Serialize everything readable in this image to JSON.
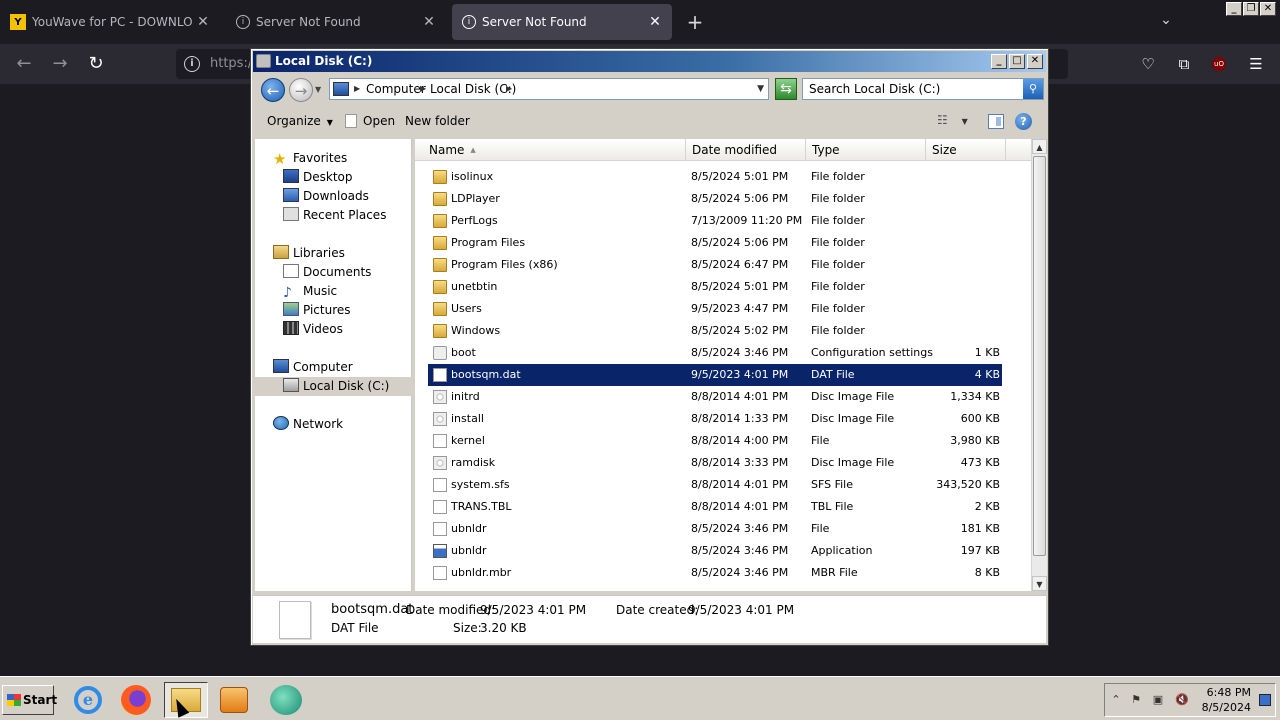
{
  "browser": {
    "tabs": [
      {
        "title": "YouWave for PC - DOWNLOAD",
        "active": false
      },
      {
        "title": "Server Not Found",
        "active": false
      },
      {
        "title": "Server Not Found",
        "active": true
      }
    ],
    "new_tab_glyph": "+",
    "url_text": "https:/"
  },
  "explorer": {
    "title": "Local Disk (C:)",
    "address": {
      "crumbs": [
        "Computer",
        "Local Disk (C:)"
      ]
    },
    "search_placeholder": "Search Local Disk (C:)",
    "commands": {
      "organize": "Organize",
      "open": "Open",
      "new_folder": "New folder"
    },
    "nav": {
      "favorites": "Favorites",
      "desktop": "Desktop",
      "downloads": "Downloads",
      "recent": "Recent Places",
      "libraries": "Libraries",
      "documents": "Documents",
      "music": "Music",
      "pictures": "Pictures",
      "videos": "Videos",
      "computer": "Computer",
      "local_disk": "Local Disk (C:)",
      "network": "Network"
    },
    "columns": {
      "name": "Name",
      "date": "Date modified",
      "type": "Type",
      "size": "Size"
    },
    "files": [
      {
        "name": "isolinux",
        "date": "8/5/2024 5:01 PM",
        "type": "File folder",
        "size": "",
        "icon": "folder"
      },
      {
        "name": "LDPlayer",
        "date": "8/5/2024 5:06 PM",
        "type": "File folder",
        "size": "",
        "icon": "folder"
      },
      {
        "name": "PerfLogs",
        "date": "7/13/2009 11:20 PM",
        "type": "File folder",
        "size": "",
        "icon": "folder"
      },
      {
        "name": "Program Files",
        "date": "8/5/2024 5:06 PM",
        "type": "File folder",
        "size": "",
        "icon": "folder"
      },
      {
        "name": "Program Files (x86)",
        "date": "8/5/2024 6:47 PM",
        "type": "File folder",
        "size": "",
        "icon": "folder"
      },
      {
        "name": "unetbtin",
        "date": "8/5/2024 5:01 PM",
        "type": "File folder",
        "size": "",
        "icon": "folder"
      },
      {
        "name": "Users",
        "date": "9/5/2023 4:47 PM",
        "type": "File folder",
        "size": "",
        "icon": "folder"
      },
      {
        "name": "Windows",
        "date": "8/5/2024 5:02 PM",
        "type": "File folder",
        "size": "",
        "icon": "folder"
      },
      {
        "name": "boot",
        "date": "8/5/2024 3:46 PM",
        "type": "Configuration settings",
        "size": "1 KB",
        "icon": "gear"
      },
      {
        "name": "bootsqm.dat",
        "date": "9/5/2023 4:01 PM",
        "type": "DAT File",
        "size": "4 KB",
        "icon": "file",
        "selected": true
      },
      {
        "name": "initrd",
        "date": "8/8/2014 4:01 PM",
        "type": "Disc Image File",
        "size": "1,334 KB",
        "icon": "disc"
      },
      {
        "name": "install",
        "date": "8/8/2014 1:33 PM",
        "type": "Disc Image File",
        "size": "600 KB",
        "icon": "disc"
      },
      {
        "name": "kernel",
        "date": "8/8/2014 4:00 PM",
        "type": "File",
        "size": "3,980 KB",
        "icon": "file"
      },
      {
        "name": "ramdisk",
        "date": "8/8/2014 3:33 PM",
        "type": "Disc Image File",
        "size": "473 KB",
        "icon": "disc"
      },
      {
        "name": "system.sfs",
        "date": "8/8/2014 4:01 PM",
        "type": "SFS File",
        "size": "343,520 KB",
        "icon": "file"
      },
      {
        "name": "TRANS.TBL",
        "date": "8/8/2014 4:01 PM",
        "type": "TBL File",
        "size": "2 KB",
        "icon": "file"
      },
      {
        "name": "ubnldr",
        "date": "8/5/2024 3:46 PM",
        "type": "File",
        "size": "181 KB",
        "icon": "file"
      },
      {
        "name": "ubnldr",
        "date": "8/5/2024 3:46 PM",
        "type": "Application",
        "size": "197 KB",
        "icon": "app"
      },
      {
        "name": "ubnldr.mbr",
        "date": "8/5/2024 3:46 PM",
        "type": "MBR File",
        "size": "8 KB",
        "icon": "file"
      }
    ],
    "details": {
      "name": "bootsqm.dat",
      "type": "DAT File",
      "modified_label": "Date modified:",
      "modified_value": "9/5/2023 4:01 PM",
      "created_label": "Date created:",
      "created_value": "9/5/2023 4:01 PM",
      "size_label": "Size:",
      "size_value": "3.20 KB"
    }
  },
  "taskbar": {
    "start_label": "Start",
    "clock_time": "6:48 PM",
    "clock_date": "8/5/2024"
  },
  "colors": {
    "selection": "#0a246a",
    "titlebar": "#0a246a",
    "classic_face": "#d4d0c8"
  }
}
